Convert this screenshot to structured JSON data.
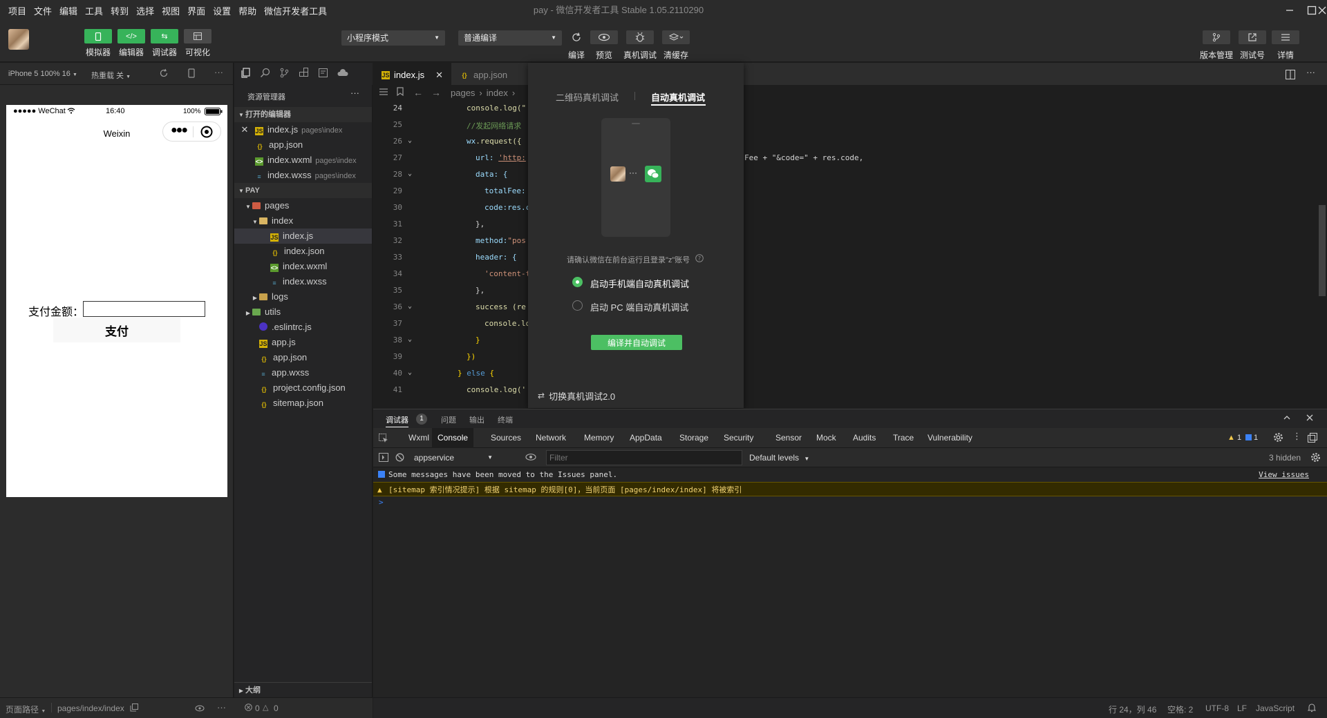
{
  "menu": [
    "项目",
    "文件",
    "编辑",
    "工具",
    "转到",
    "选择",
    "视图",
    "界面",
    "设置",
    "帮助",
    "微信开发者工具"
  ],
  "window_title": "pay - 微信开发者工具 Stable 1.05.2110290",
  "toolbar": {
    "simulator": "模拟器",
    "editor": "编辑器",
    "debugger": "调试器",
    "visual": "可视化",
    "mode": "小程序模式",
    "compile_mode": "普通编译",
    "compile": "编译",
    "preview": "预览",
    "remote_debug": "真机调试",
    "clear_cache": "清缓存",
    "version": "版本管理",
    "test_account": "测试号",
    "details": "详情"
  },
  "simulator": {
    "device": "iPhone 5 100% 16",
    "hot_reload": "热重载 关",
    "status_carrier": "●●●●● WeChat",
    "status_time": "16:40",
    "status_battery": "100%",
    "nav_title": "Weixin",
    "pay_label": "支付金额：",
    "pay_input_value": "",
    "pay_button": "支付"
  },
  "explorer": {
    "title": "资源管理器",
    "open_editors": "打开的编辑器",
    "open_files": [
      {
        "name": "index.js",
        "hint": "pages\\index"
      },
      {
        "name": "app.json",
        "hint": ""
      },
      {
        "name": "index.wxml",
        "hint": "pages\\index"
      },
      {
        "name": "index.wxss",
        "hint": "pages\\index"
      }
    ],
    "project": "PAY",
    "tree": {
      "pages": "pages",
      "index": "index",
      "index_js": "index.js",
      "index_json": "index.json",
      "index_wxml": "index.wxml",
      "index_wxss": "index.wxss",
      "logs": "logs",
      "utils": "utils",
      "eslintrc": ".eslintrc.js",
      "app_js": "app.js",
      "app_json": "app.json",
      "app_wxss": "app.wxss",
      "project_config": "project.config.json",
      "sitemap": "sitemap.json"
    },
    "outline": "大纲"
  },
  "editor": {
    "tab_active": "index.js",
    "tab_inactive": "app.json",
    "breadcrumb_pages": "pages",
    "breadcrumb_index": "index",
    "line_numbers": [
      "24",
      "25",
      "26",
      "27",
      "28",
      "29",
      "30",
      "31",
      "32",
      "33",
      "34",
      "35",
      "36",
      "37",
      "38",
      "39",
      "40",
      "41"
    ],
    "code": {
      "l24": "console.log(\"",
      "l25": "//发起网络请求",
      "l26a": "wx",
      "l26b": ".request({",
      "l27a": "url: ",
      "l27b": "'http:",
      "l27c": "Fee + \"&code=\" + res.code,",
      "l28": "data: {",
      "l29": "totalFee:",
      "l30": "code:res.c",
      "l31": "},",
      "l32a": "method:",
      "l32b": "\"pos",
      "l33": "header: {",
      "l34": "'content-t",
      "l35": "},",
      "l36": "success (re",
      "l37": "console.lo",
      "l38": "}",
      "l39": "})",
      "l40a": "} ",
      "l40b": "else",
      "l40c": " {",
      "l41": "console.log('"
    }
  },
  "popup": {
    "tab_qr": "二维码真机调试",
    "tab_auto": "自动真机调试",
    "hint": "请确认微信在前台运行且登录\"z\"账号",
    "option_mobile": "启动手机端自动真机调试",
    "option_pc": "启动 PC 端自动真机调试",
    "button": "编译并自动调试",
    "switch": "切换真机调试2.0"
  },
  "panel": {
    "tabs": [
      "调试器",
      "问题",
      "输出",
      "终端"
    ],
    "badge": "1"
  },
  "devtools": {
    "tabs": [
      "Wxml",
      "Console",
      "Sources",
      "Network",
      "Memory",
      "AppData",
      "Storage",
      "Security",
      "Sensor",
      "Mock",
      "Audits",
      "Trace",
      "Vulnerability"
    ],
    "warn_count": "1",
    "info_count": "1",
    "context": "appservice",
    "filter_placeholder": "Filter",
    "levels": "Default levels",
    "hidden": "3 hidden"
  },
  "console": {
    "msg_info": "Some messages have been moved to the Issues panel.",
    "view_issues": "View issues",
    "msg_warn": "[sitemap 索引情况提示] 根据 sitemap 的规则[0]，当前页面 [pages/index/index] 将被索引",
    "prompt": ">"
  },
  "statusbar": {
    "page_path_label": "页面路径",
    "page_path": "pages/index/index",
    "errors": "0",
    "warnings": "0",
    "position": "行 24，列 46",
    "spaces": "空格: 2",
    "encoding": "UTF-8",
    "eol": "LF",
    "language": "JavaScript"
  },
  "colors": {
    "accent_green": "#37b35a",
    "warn_yellow": "#f2d373",
    "info_blue": "#3b82f6"
  }
}
